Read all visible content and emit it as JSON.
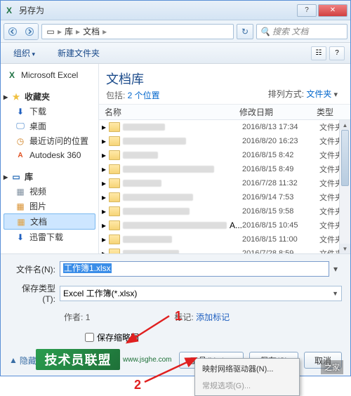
{
  "window": {
    "title": "另存为"
  },
  "addressbar": {
    "seg1": "库",
    "seg2": "文档",
    "search_placeholder": "搜索 文档"
  },
  "toolbar": {
    "organize": "组织",
    "newfolder": "新建文件夹"
  },
  "sidebar": {
    "excel": "Microsoft Excel",
    "fav": "收藏夹",
    "downloads": "下载",
    "desktop": "桌面",
    "recent": "最近访问的位置",
    "autodesk": "Autodesk 360",
    "libs": "库",
    "videos": "视频",
    "pictures": "图片",
    "docs": "文档",
    "xldl": "迅雷下载"
  },
  "main": {
    "title": "文档库",
    "subtitle_prefix": "包括: ",
    "subtitle_link": "2 个位置",
    "sort_prefix": "排列方式: ",
    "sort_link": "文件夹",
    "col_name": "名称",
    "col_date": "修改日期",
    "col_type": "类型"
  },
  "files": [
    {
      "date": "2016/8/13 17:34",
      "type": "文件夹"
    },
    {
      "date": "2016/8/20 16:23",
      "type": "文件夹"
    },
    {
      "date": "2016/8/15 8:42",
      "type": "文件夹"
    },
    {
      "date": "2016/8/15 8:49",
      "type": "文件夹"
    },
    {
      "date": "2016/7/28 11:32",
      "type": "文件夹"
    },
    {
      "date": "2016/9/14 7:53",
      "type": "文件夹"
    },
    {
      "date": "2016/8/15 9:58",
      "type": "文件夹"
    },
    {
      "date": "2016/8/15 10:45",
      "type": "文件夹"
    },
    {
      "date": "2016/8/15 11:00",
      "type": "文件夹"
    },
    {
      "date": "2016/7/28 8:59",
      "type": "文件夹"
    }
  ],
  "form": {
    "filename_label": "文件名(N):",
    "filename_value": "工作簿1.xlsx",
    "filetype_label": "保存类型(T):",
    "filetype_value": "Excel 工作簿(*.xlsx)",
    "author_label": "作者:",
    "author_value": "1",
    "tags_label": "标记:",
    "tags_value": "添加标记",
    "thumbnail": "保存缩略图"
  },
  "buttons": {
    "hide": "隐藏文件夹",
    "tools": "工具(L)",
    "save": "保存(S)",
    "cancel": "取消"
  },
  "toolmenu": {
    "item1": "映射网络驱动器(N)...",
    "item2": "常规选项(G)..."
  },
  "annotations": {
    "n1": "1",
    "n2": "2"
  },
  "watermark": {
    "logo": "技术员联盟",
    "site1": "www.jsghe.com",
    "site2": "之家"
  }
}
